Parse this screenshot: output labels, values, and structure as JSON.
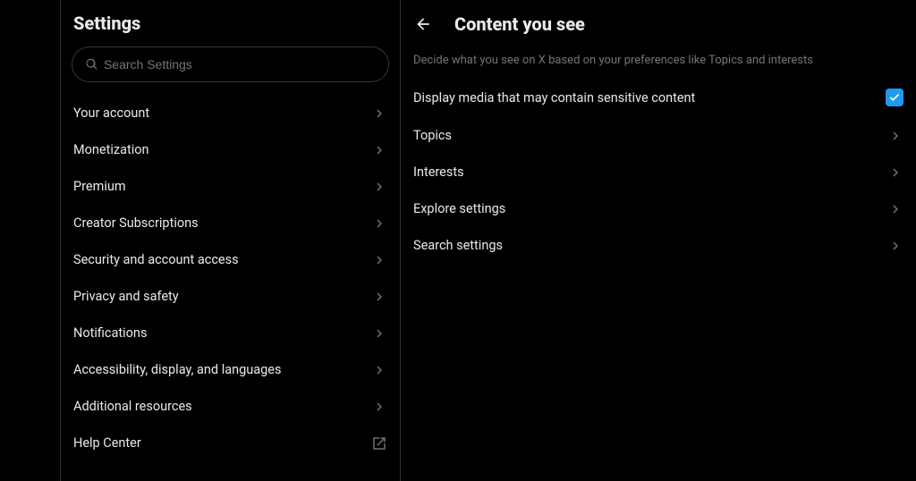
{
  "sidebar": {
    "title": "Settings",
    "searchPlaceholder": "Search Settings",
    "items": [
      {
        "label": "Your account",
        "external": false
      },
      {
        "label": "Monetization",
        "external": false
      },
      {
        "label": "Premium",
        "external": false
      },
      {
        "label": "Creator Subscriptions",
        "external": false
      },
      {
        "label": "Security and account access",
        "external": false
      },
      {
        "label": "Privacy and safety",
        "external": false
      },
      {
        "label": "Notifications",
        "external": false
      },
      {
        "label": "Accessibility, display, and languages",
        "external": false
      },
      {
        "label": "Additional resources",
        "external": false
      },
      {
        "label": "Help Center",
        "external": true
      }
    ]
  },
  "detail": {
    "title": "Content you see",
    "description": "Decide what you see on X based on your preferences like Topics and interests",
    "toggle": {
      "label": "Display media that may contain sensitive content",
      "checked": true
    },
    "items": [
      {
        "label": "Topics"
      },
      {
        "label": "Interests"
      },
      {
        "label": "Explore settings"
      },
      {
        "label": "Search settings"
      }
    ]
  },
  "colors": {
    "accent": "#1d9bf0",
    "text": "#e7e9ea",
    "muted": "#71767b",
    "border": "#2f3336"
  }
}
